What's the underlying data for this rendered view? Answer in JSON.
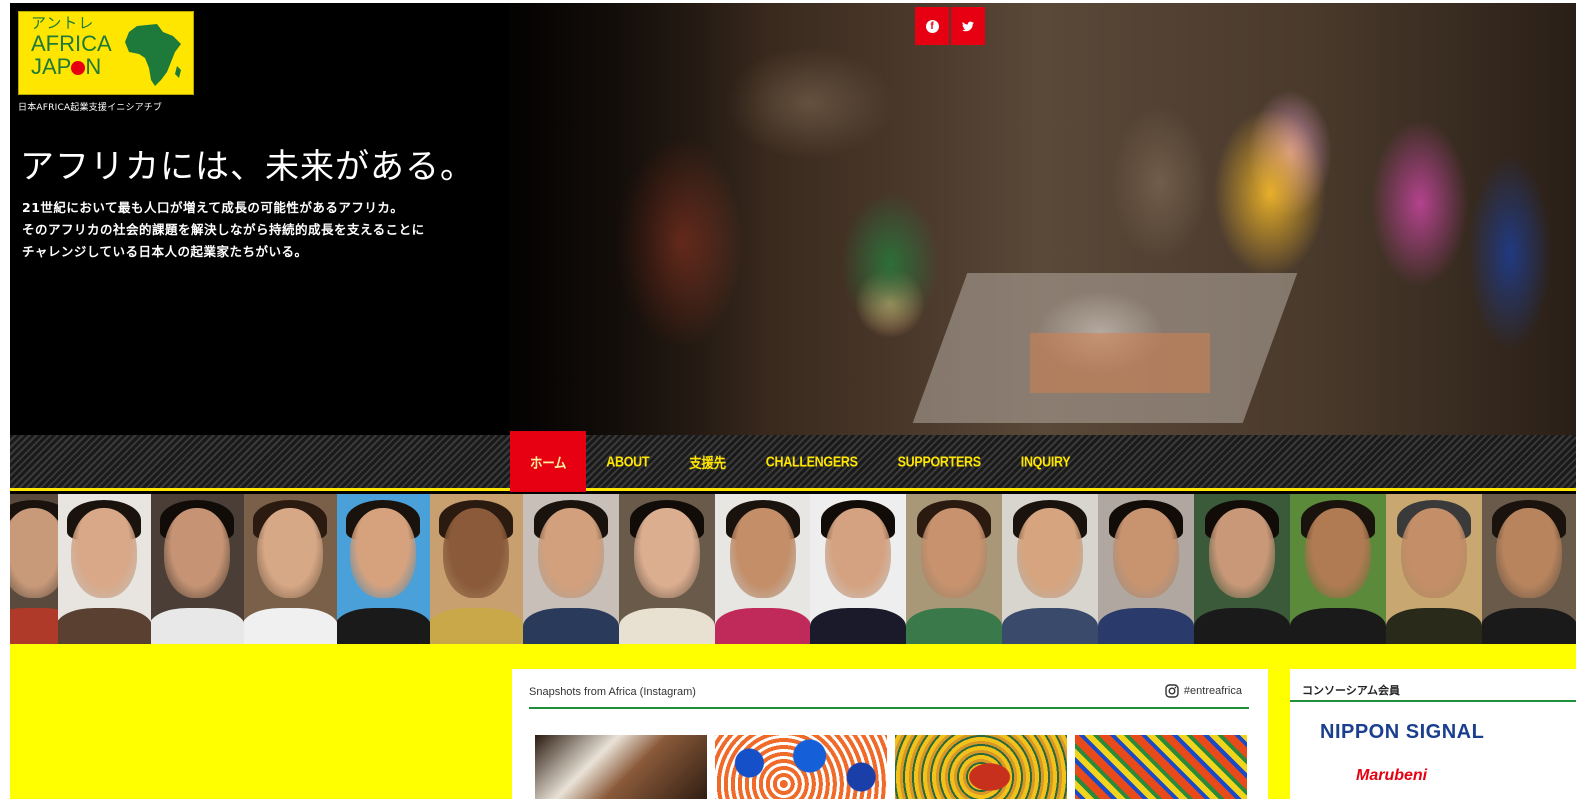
{
  "logo": {
    "kana": "アントレ",
    "line1": "AFRICA",
    "line2_a": "JAP",
    "line2_b": "N",
    "subtitle": "日本AFRICA起業支援イニシアチブ"
  },
  "hero": {
    "title": "アフリカには、未来がある。",
    "lead": [
      "21世紀において最も人口が増えて成長の可能性があるアフリカ。",
      "そのアフリカの社会的課題を解決しながら持続的成長を支えることに",
      "チャレンジしている日本人の起業家たちがいる。"
    ]
  },
  "social": {
    "facebook_icon": "facebook-icon",
    "twitter_icon": "twitter-icon",
    "facebook_glyph": "f",
    "twitter_glyph": "🐦"
  },
  "nav": {
    "items": [
      {
        "label": "ホーム",
        "active": true
      },
      {
        "label": "ABOUT"
      },
      {
        "label": "支援先"
      },
      {
        "label": "CHALLENGERS"
      },
      {
        "label": "SUPPORTERS"
      },
      {
        "label": "INQUIRY"
      }
    ]
  },
  "colors": {
    "brand_yellow": "#ffe600",
    "brand_red": "#e60012",
    "brand_green": "#1f8f3a"
  },
  "instagram": {
    "title": "Snapshots from Africa (Instagram)",
    "hashtag": "#entreafrica"
  },
  "consortium": {
    "title": "コンソーシアム会員",
    "members": [
      "NIPPON SIGNAL",
      "Marubeni"
    ]
  }
}
